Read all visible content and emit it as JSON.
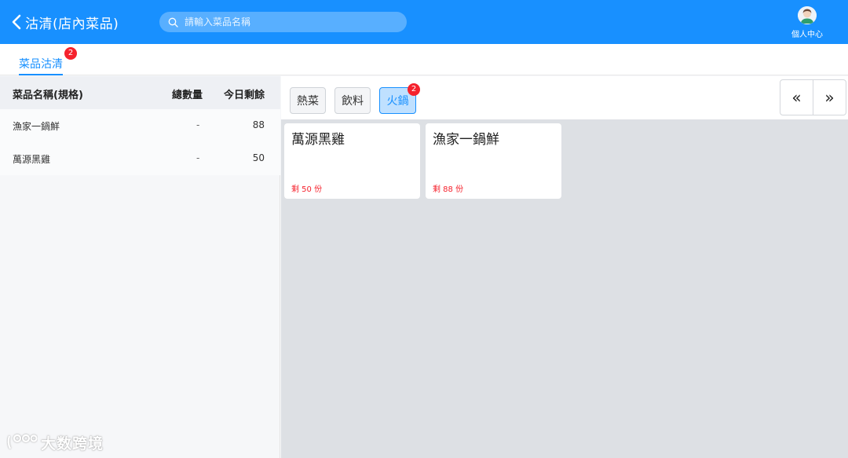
{
  "header": {
    "back_title": "沽清(店內菜品)",
    "search_placeholder": "請輸入菜品名稱",
    "search_value": "",
    "profile_label": "個人中心"
  },
  "tabs": [
    {
      "label": "菜品沽清",
      "badge": "2",
      "active": true
    }
  ],
  "table": {
    "columns": [
      "菜品名稱(規格)",
      "總數量",
      "今日剩餘"
    ],
    "rows": [
      {
        "name": "漁家一鍋鮮",
        "total": "-",
        "remain": "88"
      },
      {
        "name": "萬源黑雞",
        "total": "-",
        "remain": "50"
      }
    ]
  },
  "categories": [
    {
      "label": "熱菜",
      "active": false
    },
    {
      "label": "飲料",
      "active": false
    },
    {
      "label": "火鍋",
      "active": true,
      "badge": "2"
    }
  ],
  "pager": {
    "prev": "«",
    "next": "»"
  },
  "cards": [
    {
      "name": "萬源黑雞",
      "remain": "剩 50 份"
    },
    {
      "name": "漁家一鍋鮮",
      "remain": "剩 88 份"
    }
  ],
  "watermark": {
    "text": "大数跨境"
  },
  "colors": {
    "primary": "#1890ff",
    "badge": "#f5222d",
    "content_bg": "#dde0e4"
  },
  "icons": {
    "back": "chevron-left-icon",
    "search": "search-icon",
    "avatar": "user-avatar-icon"
  }
}
